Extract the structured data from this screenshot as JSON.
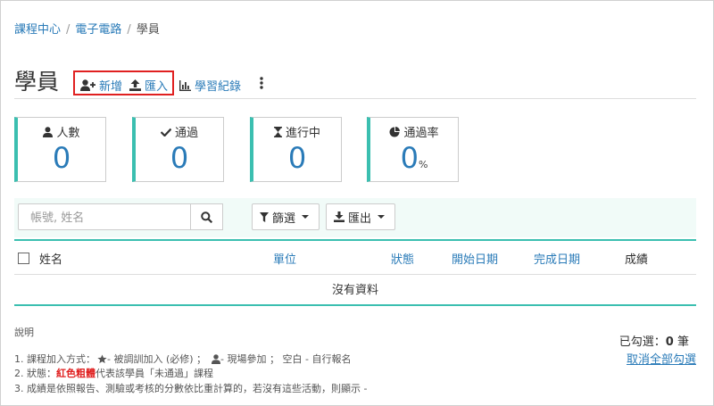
{
  "breadcrumb": {
    "items": [
      "課程中心",
      "電子電路",
      "學員"
    ],
    "sep": "/"
  },
  "page": {
    "title": "學員"
  },
  "toolbar": {
    "add_label": "新增",
    "import_label": "匯入",
    "records_label": "學習紀錄"
  },
  "stats": [
    {
      "label": "人數",
      "value": "0",
      "unit": ""
    },
    {
      "label": "通過",
      "value": "0",
      "unit": ""
    },
    {
      "label": "進行中",
      "value": "0",
      "unit": ""
    },
    {
      "label": "通過率",
      "value": "0",
      "unit": "%"
    }
  ],
  "search": {
    "placeholder": "帳號, 姓名",
    "value": ""
  },
  "filter": {
    "label": "篩選"
  },
  "export": {
    "label": "匯出"
  },
  "table": {
    "columns": [
      "姓名",
      "單位",
      "狀態",
      "開始日期",
      "完成日期",
      "成績"
    ],
    "empty_text": "沒有資料"
  },
  "notes": {
    "title": "說明",
    "line1_a": "1. 課程加入方式：",
    "line1_b": " - 被調訓加入 (必修)  ；",
    "line1_c": " - 現場參加  ；  空白 - 自行報名",
    "line2_a": "2. 狀態：",
    "line2_red": "紅色粗體",
    "line2_b": "代表該學員「未通過」課程",
    "line3": "3. 成績是依照報告、測驗或考核的分數依比重計算的，若沒有這些活動，則顯示 -"
  },
  "selection": {
    "label": "已勾選：",
    "count": "0",
    "unit": "筆",
    "clear_label": "取消全部勾選"
  },
  "colors": {
    "accent": "#3bbfb0",
    "link": "#2a7bb8",
    "highlight": "#e02020"
  }
}
